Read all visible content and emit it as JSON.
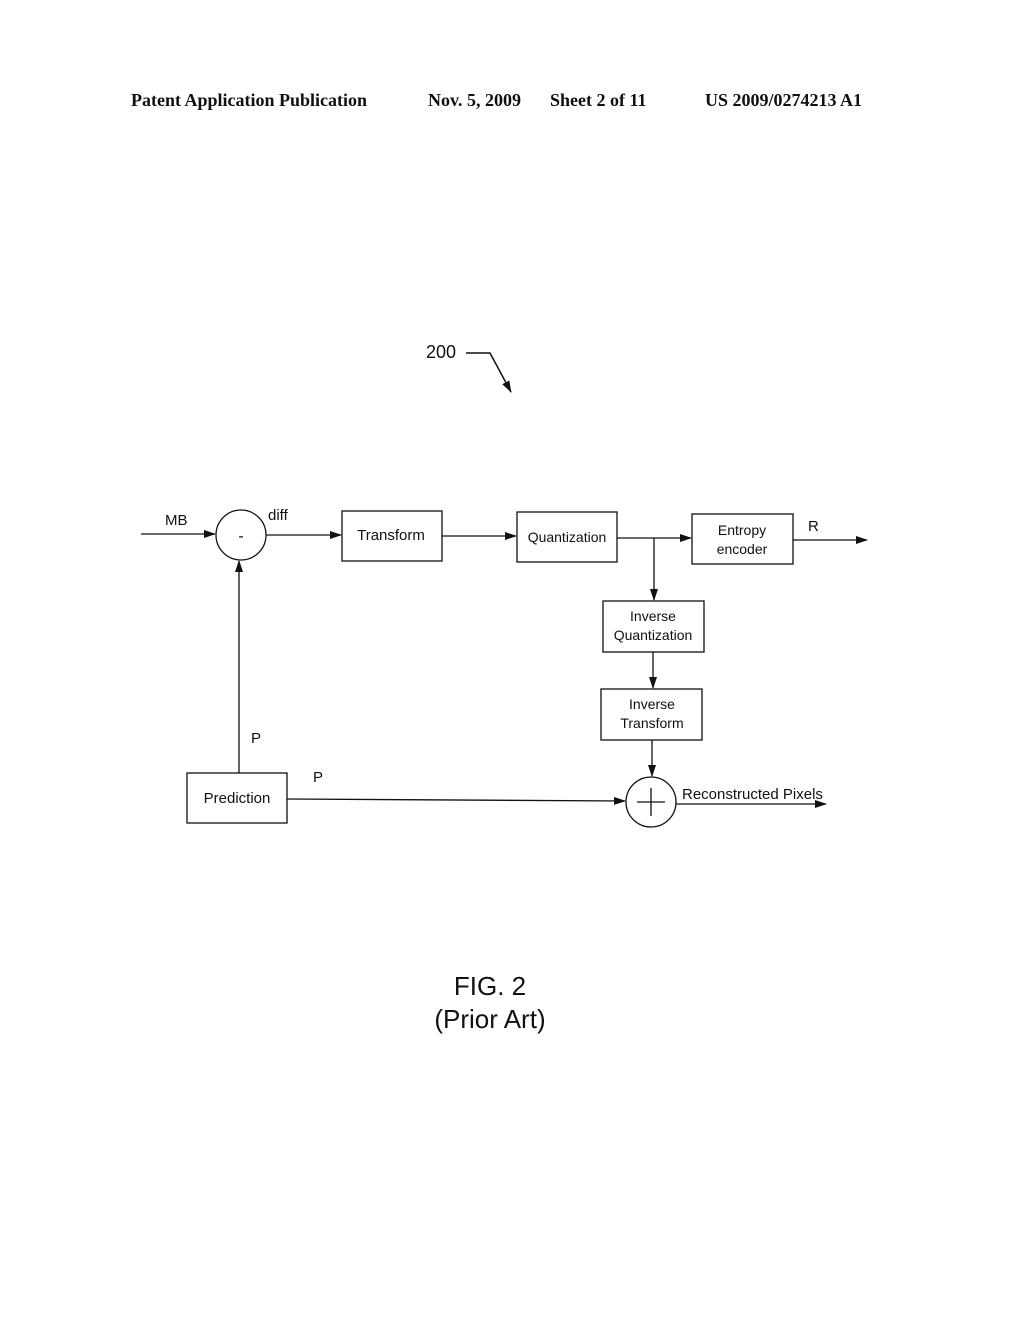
{
  "header": {
    "publication": "Patent Application Publication",
    "date": "Nov. 5, 2009",
    "sheet": "Sheet 2 of 11",
    "number": "US 2009/0274213 A1"
  },
  "figure": {
    "reference": "200",
    "caption": "FIG. 2",
    "subcaption": "(Prior Art)"
  },
  "diagram": {
    "input_label": "MB",
    "subtractor_symbol": "-",
    "diff_label": "diff",
    "blocks": {
      "transform": "Transform",
      "quantization": "Quantization",
      "entropy_line1": "Entropy",
      "entropy_line2": "encoder",
      "inv_quant_line1": "Inverse",
      "inv_quant_line2": "Quantization",
      "inv_transform_line1": "Inverse",
      "inv_transform_line2": "Transform",
      "prediction": "Prediction"
    },
    "output_label": "R",
    "p_label_vertical": "P",
    "p_label_horizontal": "P",
    "reconstructed_label": "Reconstructed Pixels"
  }
}
